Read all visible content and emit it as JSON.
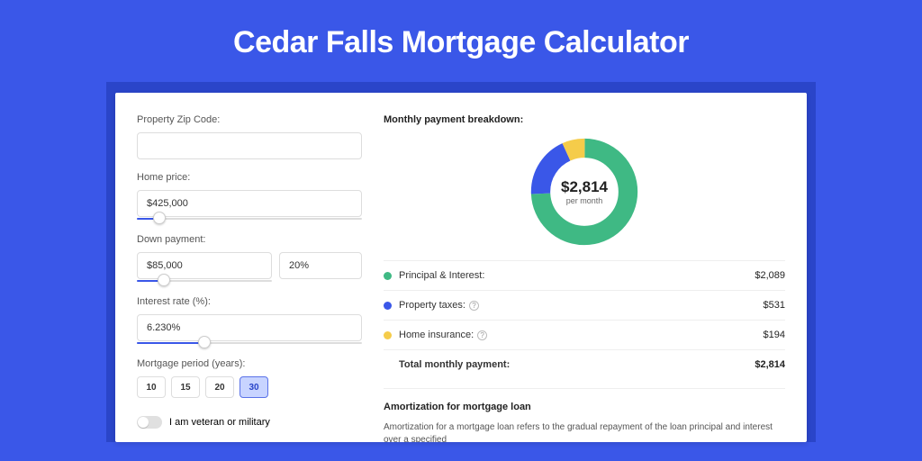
{
  "title": "Cedar Falls Mortgage Calculator",
  "form": {
    "zip_label": "Property Zip Code:",
    "zip_value": "",
    "home_price_label": "Home price:",
    "home_price_value": "$425,000",
    "home_price_slider_pct": 10,
    "down_payment_label": "Down payment:",
    "down_payment_value": "$85,000",
    "down_payment_pct_value": "20%",
    "down_payment_slider_pct": 20,
    "interest_label": "Interest rate (%):",
    "interest_value": "6.230%",
    "interest_slider_pct": 30,
    "period_label": "Mortgage period (years):",
    "period_options": [
      "10",
      "15",
      "20",
      "30"
    ],
    "period_selected": "30",
    "veteran_label": "I am veteran or military"
  },
  "breakdown": {
    "title": "Monthly payment breakdown:",
    "amount": "$2,814",
    "per_month": "per month",
    "items": [
      {
        "label": "Principal & Interest:",
        "value": "$2,089",
        "color": "#3fb984",
        "help": false
      },
      {
        "label": "Property taxes:",
        "value": "$531",
        "color": "#3a57e8",
        "help": true
      },
      {
        "label": "Home insurance:",
        "value": "$194",
        "color": "#f5cc4a",
        "help": true
      }
    ],
    "total_label": "Total monthly payment:",
    "total_value": "$2,814"
  },
  "chart_data": {
    "type": "pie",
    "title": "Monthly payment breakdown",
    "series": [
      {
        "name": "Principal & Interest",
        "value": 2089,
        "color": "#3fb984"
      },
      {
        "name": "Property taxes",
        "value": 531,
        "color": "#3a57e8"
      },
      {
        "name": "Home insurance",
        "value": 194,
        "color": "#f5cc4a"
      }
    ],
    "center_label": "$2,814 per month"
  },
  "amortization": {
    "title": "Amortization for mortgage loan",
    "text": "Amortization for a mortgage loan refers to the gradual repayment of the loan principal and interest over a specified"
  }
}
